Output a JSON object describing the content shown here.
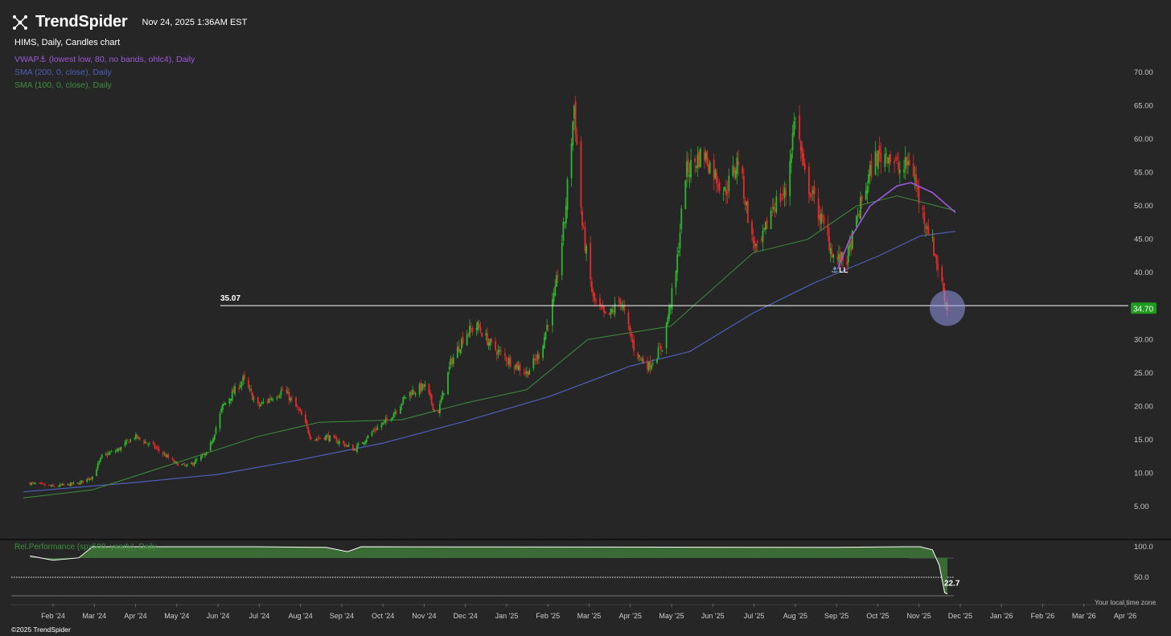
{
  "header": {
    "brand": "TrendSpider",
    "timestamp": "Nov 24, 2025 1:36AM EST",
    "symbol_line": "HIMS, Daily, Candles chart"
  },
  "indicators": [
    {
      "label": "VWAP⚓ (lowest low, 80, no bands, ohlc4), Daily",
      "color": "#9b59d8"
    },
    {
      "label": "SMA (200, 0, close), Daily",
      "color": "#4e5fb8"
    },
    {
      "label": "SMA (100, 0, close), Daily",
      "color": "#3f8f3f"
    }
  ],
  "colors": {
    "up": "#2fb52f",
    "down": "#e52b2b",
    "bg": "#262626",
    "grid": "#333333"
  },
  "footer": {
    "copyright": "©2025 TrendSpider",
    "timezone_note": "Your local time zone"
  },
  "chart_data": [
    {
      "type": "candlestick",
      "title": "",
      "price_axis_ticks": [
        "70.00",
        "65.00",
        "60.00",
        "55.00",
        "50.00",
        "45.00",
        "40.00",
        "35.00",
        "30.00",
        "25.00",
        "20.00",
        "15.00",
        "10.00",
        "5.00"
      ],
      "ylim": [
        0,
        74
      ],
      "x_labels": [
        "Feb '24",
        "Mar '24",
        "Apr '24",
        "May '24",
        "Jun '24",
        "Jul '24",
        "Aug '24",
        "Sep '24",
        "Oct '24",
        "Nov '24",
        "Dec '24",
        "Jan '25",
        "Feb '25",
        "Mar '25",
        "Apr '25",
        "May '25",
        "Jun '25",
        "Jul '25",
        "Aug '25",
        "Sep '25",
        "Oct '25",
        "Nov '25",
        "Dec '25",
        "Jan '26",
        "Feb '26",
        "Mar '26",
        "Apr '26"
      ],
      "horizontal_line": {
        "value": 35.07,
        "label": "35.07"
      },
      "last_price": {
        "value": 34.7,
        "label": "34.70"
      },
      "anchor_label": "LL",
      "close_path": [
        [
          "2024-01-15",
          8.5
        ],
        [
          "2024-02-01",
          8.0
        ],
        [
          "2024-02-20",
          8.5
        ],
        [
          "2024-03-01",
          9.5
        ],
        [
          "2024-03-08",
          12.5
        ],
        [
          "2024-03-20",
          13.5
        ],
        [
          "2024-04-01",
          15.5
        ],
        [
          "2024-04-15",
          14.0
        ],
        [
          "2024-05-01",
          11.5
        ],
        [
          "2024-05-10",
          11.0
        ],
        [
          "2024-05-25",
          13.0
        ],
        [
          "2024-06-05",
          20.0
        ],
        [
          "2024-06-20",
          24.0
        ],
        [
          "2024-07-01",
          20.0
        ],
        [
          "2024-07-20",
          22.5
        ],
        [
          "2024-08-01",
          19.0
        ],
        [
          "2024-08-10",
          15.0
        ],
        [
          "2024-08-20",
          15.5
        ],
        [
          "2024-09-01",
          14.5
        ],
        [
          "2024-09-10",
          13.5
        ],
        [
          "2024-09-25",
          16.5
        ],
        [
          "2024-10-05",
          18.0
        ],
        [
          "2024-10-20",
          22.0
        ],
        [
          "2024-11-01",
          23.0
        ],
        [
          "2024-11-10",
          18.5
        ],
        [
          "2024-11-20",
          26.5
        ],
        [
          "2024-12-01",
          31.0
        ],
        [
          "2024-12-10",
          32.0
        ],
        [
          "2024-12-20",
          29.0
        ],
        [
          "2025-01-01",
          27.0
        ],
        [
          "2025-01-15",
          25.0
        ],
        [
          "2025-01-25",
          28.0
        ],
        [
          "2025-02-05",
          37.0
        ],
        [
          "2025-02-12",
          48.0
        ],
        [
          "2025-02-19",
          65.0
        ],
        [
          "2025-02-25",
          47.0
        ],
        [
          "2025-03-05",
          36.0
        ],
        [
          "2025-03-15",
          33.0
        ],
        [
          "2025-03-25",
          36.0
        ],
        [
          "2025-04-05",
          28.0
        ],
        [
          "2025-04-15",
          26.0
        ],
        [
          "2025-04-25",
          29.0
        ],
        [
          "2025-05-05",
          40.0
        ],
        [
          "2025-05-12",
          55.0
        ],
        [
          "2025-05-25",
          58.0
        ],
        [
          "2025-06-10",
          52.0
        ],
        [
          "2025-06-20",
          57.0
        ],
        [
          "2025-06-30",
          45.0
        ],
        [
          "2025-07-05",
          43.0
        ],
        [
          "2025-07-15",
          50.0
        ],
        [
          "2025-07-25",
          52.0
        ],
        [
          "2025-08-01",
          64.0
        ],
        [
          "2025-08-07",
          55.0
        ],
        [
          "2025-08-20",
          48.0
        ],
        [
          "2025-08-30",
          42.0
        ],
        [
          "2025-09-08",
          42.0
        ],
        [
          "2025-09-18",
          50.0
        ],
        [
          "2025-09-28",
          57.0
        ],
        [
          "2025-10-08",
          58.0
        ],
        [
          "2025-10-18",
          55.0
        ],
        [
          "2025-10-25",
          57.0
        ],
        [
          "2025-11-01",
          50.0
        ],
        [
          "2025-11-08",
          46.0
        ],
        [
          "2025-11-15",
          40.0
        ],
        [
          "2025-11-21",
          34.7
        ]
      ],
      "sma200": [
        [
          "2024-01-10",
          7.2
        ],
        [
          "2024-04-01",
          8.6
        ],
        [
          "2024-06-01",
          9.8
        ],
        [
          "2024-08-01",
          12.0
        ],
        [
          "2024-10-01",
          14.5
        ],
        [
          "2024-12-01",
          17.8
        ],
        [
          "2025-02-01",
          21.5
        ],
        [
          "2025-04-01",
          26.0
        ],
        [
          "2025-05-15",
          28.2
        ],
        [
          "2025-07-01",
          34.0
        ],
        [
          "2025-08-15",
          38.5
        ],
        [
          "2025-10-01",
          42.5
        ],
        [
          "2025-11-01",
          45.5
        ],
        [
          "2025-11-27",
          46.2
        ]
      ],
      "sma100": [
        [
          "2024-01-10",
          6.3
        ],
        [
          "2024-03-01",
          7.5
        ],
        [
          "2024-05-01",
          11.5
        ],
        [
          "2024-07-01",
          15.5
        ],
        [
          "2024-08-15",
          17.6
        ],
        [
          "2024-10-15",
          18.0
        ],
        [
          "2024-12-01",
          20.5
        ],
        [
          "2025-01-15",
          22.5
        ],
        [
          "2025-03-01",
          30.0
        ],
        [
          "2025-05-01",
          32.0
        ],
        [
          "2025-07-01",
          43.0
        ],
        [
          "2025-08-10",
          45.0
        ],
        [
          "2025-09-15",
          50.0
        ],
        [
          "2025-10-15",
          51.5
        ],
        [
          "2025-11-27",
          49.3
        ]
      ],
      "vwap": [
        [
          "2025-09-01",
          40.5
        ],
        [
          "2025-09-10",
          45.0
        ],
        [
          "2025-09-25",
          50.0
        ],
        [
          "2025-10-15",
          53.0
        ],
        [
          "2025-10-25",
          53.5
        ],
        [
          "2025-11-10",
          52.0
        ],
        [
          "2025-11-27",
          49.0
        ]
      ]
    },
    {
      "type": "area",
      "title": "Rel.Performance (spx500, yearly), Daily",
      "ylim": [
        0,
        100
      ],
      "ticks": [
        "100.0",
        "50.0"
      ],
      "last_value": {
        "value": 22.7,
        "label": "22.7"
      },
      "points": [
        [
          "2024-01-15",
          85
        ],
        [
          "2024-02-01",
          78
        ],
        [
          "2024-02-20",
          82
        ],
        [
          "2024-03-01",
          100
        ],
        [
          "2024-07-01",
          100
        ],
        [
          "2024-08-20",
          99
        ],
        [
          "2024-09-05",
          92
        ],
        [
          "2024-09-15",
          100
        ],
        [
          "2025-08-30",
          99
        ],
        [
          "2025-10-20",
          100
        ],
        [
          "2025-11-01",
          100
        ],
        [
          "2025-11-10",
          95
        ],
        [
          "2025-11-15",
          70
        ],
        [
          "2025-11-19",
          25
        ],
        [
          "2025-11-21",
          22.7
        ]
      ]
    }
  ]
}
